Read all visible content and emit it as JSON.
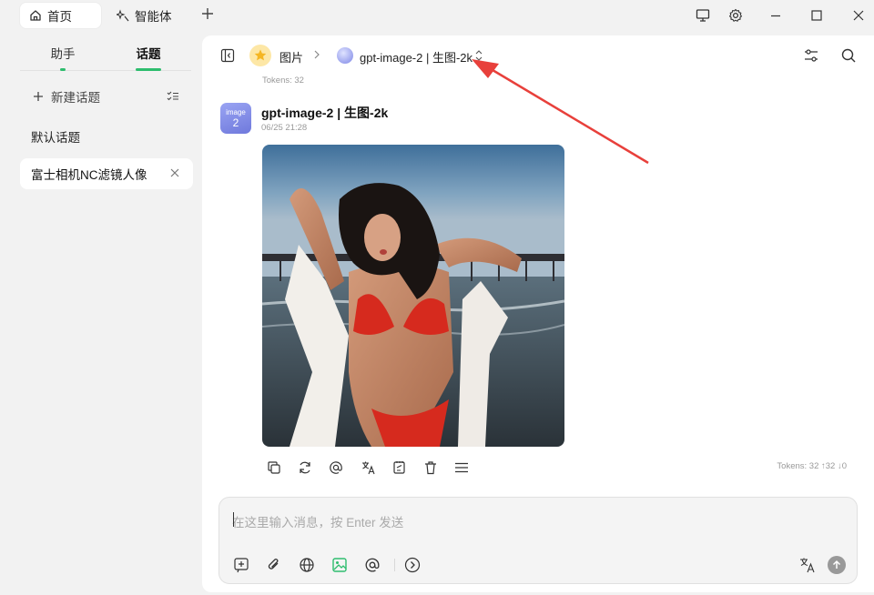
{
  "tabs": {
    "home": {
      "label": "首页",
      "icon": "home-icon"
    },
    "agent": {
      "label": "智能体",
      "icon": "sparkle-icon"
    }
  },
  "left": {
    "tab_assistant": "助手",
    "tab_topic": "话题",
    "new_topic": "新建话题",
    "default_topic": "默认话题",
    "active_topic": "富士相机NC滤镜人像"
  },
  "header": {
    "crumb_category": "图片",
    "model_name": "gpt-image-2 | 生图-2k",
    "tokens_top": "Tokens: 32"
  },
  "message": {
    "sender": "gpt-image-2 | 生图-2k",
    "time": "06/25 21:28",
    "avatar_top": "image",
    "avatar_num": "2",
    "image_alt": "woman in red bikini and open white shirt posing on a beach at dusk with a pier in the background",
    "tokens_bottom": "Tokens: 32 ↑32 ↓0"
  },
  "input": {
    "placeholder": "在这里输入消息，按 Enter 发送"
  },
  "colors": {
    "accent_green": "#2ebd6e",
    "annotation_red": "#e8403b",
    "panel_bg": "#ffffff",
    "app_bg": "#f2f2f2"
  }
}
